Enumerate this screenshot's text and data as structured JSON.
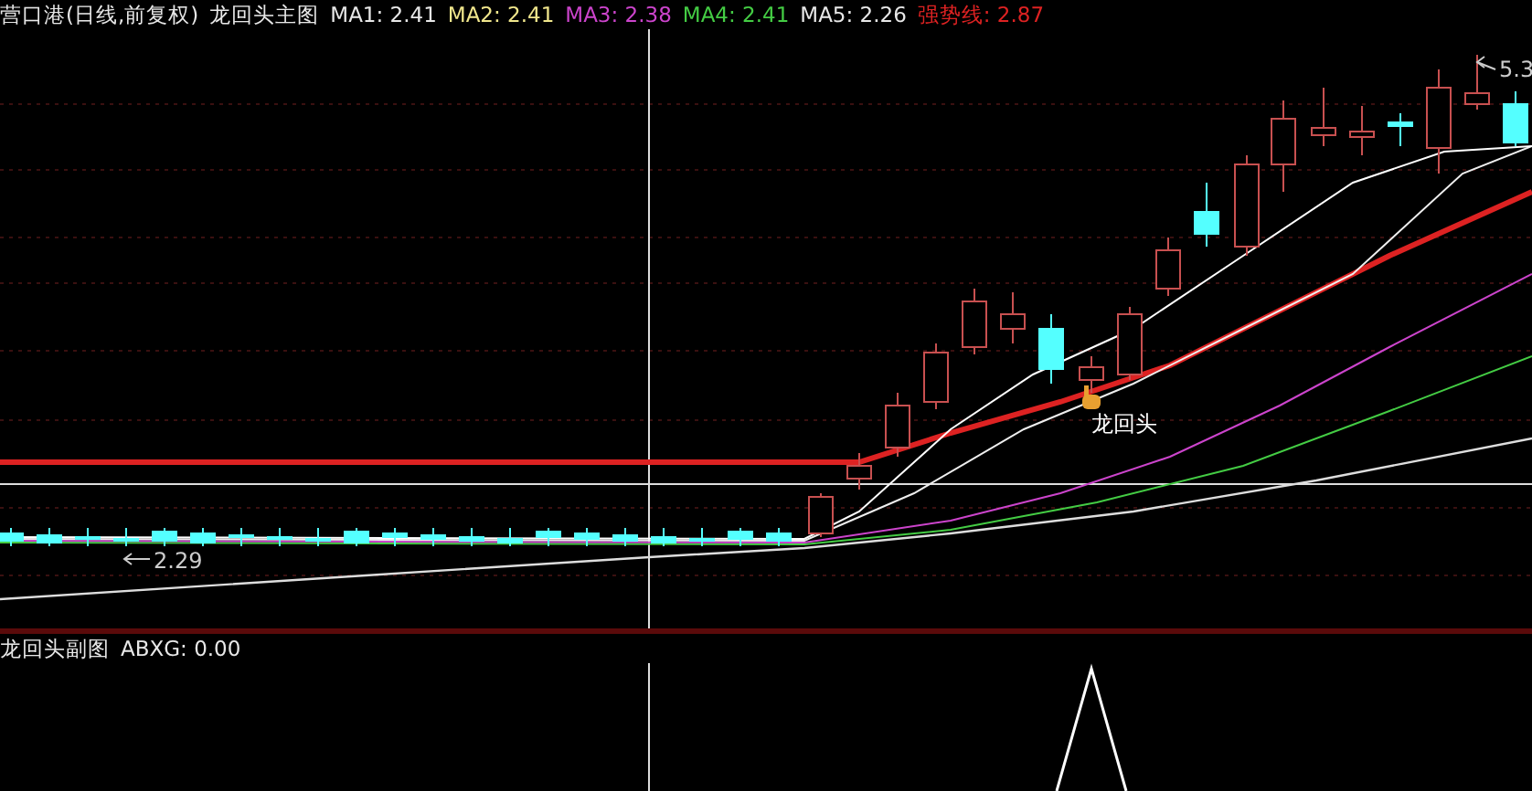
{
  "main_chart": {
    "stock": "营口港(日线,前复权)",
    "name": "龙回头主图",
    "indicators": [
      {
        "label": "MA1:",
        "value": "2.41",
        "color": "#e8e8e8"
      },
      {
        "label": "MA2:",
        "value": "2.41",
        "color": "#f0e68c"
      },
      {
        "label": "MA3:",
        "value": "2.38",
        "color": "#cc44cc"
      },
      {
        "label": "MA4:",
        "value": "2.41",
        "color": "#44cc44"
      },
      {
        "label": "MA5:",
        "value": "2.26",
        "color": "#e8e8e8"
      },
      {
        "label": "强势线:",
        "value": "2.87",
        "color": "#dd2222"
      }
    ],
    "high_label": "5.3",
    "low_label": "2.29",
    "signal_label": "龙回头"
  },
  "sub_chart": {
    "name": "龙回头副图",
    "indicators": [
      {
        "label": "ABXG:",
        "value": "0.00"
      }
    ]
  }
}
